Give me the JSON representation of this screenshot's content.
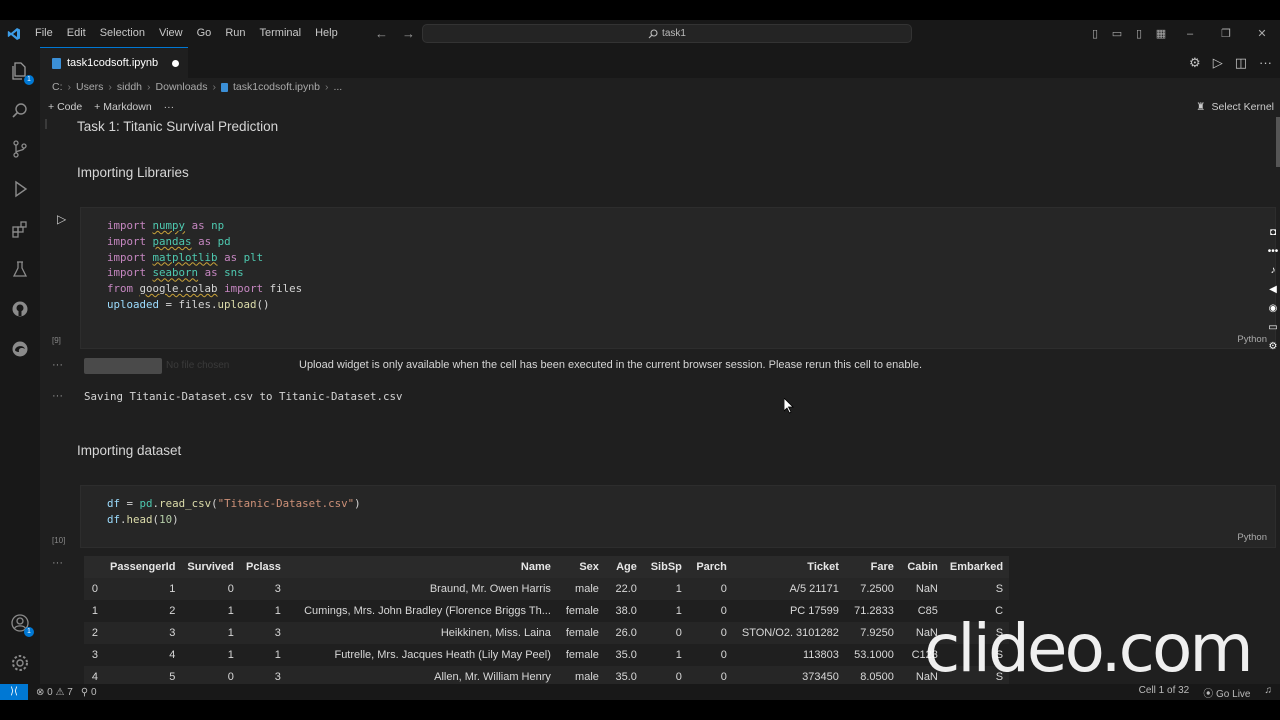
{
  "titlebar": {
    "menu": [
      "File",
      "Edit",
      "Selection",
      "View",
      "Go",
      "Run",
      "Terminal",
      "Help"
    ],
    "search": "task1"
  },
  "activity": {
    "explorer_badge": "1",
    "accounts_badge": "1"
  },
  "tab": {
    "label": "task1codsoft.ipynb"
  },
  "breadcrumb": [
    "C:",
    "Users",
    "siddh",
    "Downloads",
    "task1codsoft.ipynb",
    "..."
  ],
  "toolbar": {
    "code_label": "Code",
    "markdown_label": "Markdown",
    "more_label": "···",
    "kernel_label": "Select Kernel"
  },
  "cells": {
    "title": "Task 1: Titanic Survival Prediction",
    "importing_libraries": "Importing Libraries",
    "importing_dataset": "Importing dataset",
    "cell1_count": "[9]",
    "cell2_count": "[10]",
    "language": "Python",
    "upload_nofile": "No file chosen",
    "upload_msg": "Upload widget is only available when the cell has been executed in the current browser session. Please rerun this cell to enable.",
    "saving": "Saving Titanic-Dataset.csv to Titanic-Dataset.csv"
  },
  "dataframe": {
    "columns": [
      "",
      "PassengerId",
      "Survived",
      "Pclass",
      "Name",
      "Sex",
      "Age",
      "SibSp",
      "Parch",
      "Ticket",
      "Fare",
      "Cabin",
      "Embarked"
    ],
    "rows": [
      [
        "0",
        "1",
        "0",
        "3",
        "Braund, Mr. Owen Harris",
        "male",
        "22.0",
        "1",
        "0",
        "A/5 21171",
        "7.2500",
        "NaN",
        "S"
      ],
      [
        "1",
        "2",
        "1",
        "1",
        "Cumings, Mrs. John Bradley (Florence Briggs Th...",
        "female",
        "38.0",
        "1",
        "0",
        "PC 17599",
        "71.2833",
        "C85",
        "C"
      ],
      [
        "2",
        "3",
        "1",
        "3",
        "Heikkinen, Miss. Laina",
        "female",
        "26.0",
        "0",
        "0",
        "STON/O2. 3101282",
        "7.9250",
        "NaN",
        "S"
      ],
      [
        "3",
        "4",
        "1",
        "1",
        "Futrelle, Mrs. Jacques Heath (Lily May Peel)",
        "female",
        "35.0",
        "1",
        "0",
        "113803",
        "53.1000",
        "C123",
        "S"
      ],
      [
        "4",
        "5",
        "0",
        "3",
        "Allen, Mr. William Henry",
        "male",
        "35.0",
        "0",
        "0",
        "373450",
        "8.0500",
        "NaN",
        "S"
      ]
    ]
  },
  "statusbar": {
    "errors": "0",
    "warnings": "7",
    "ports": "0",
    "cell_position": "Cell 1 of 32",
    "go_live": "Go Live"
  },
  "watermark": "clideo.com"
}
